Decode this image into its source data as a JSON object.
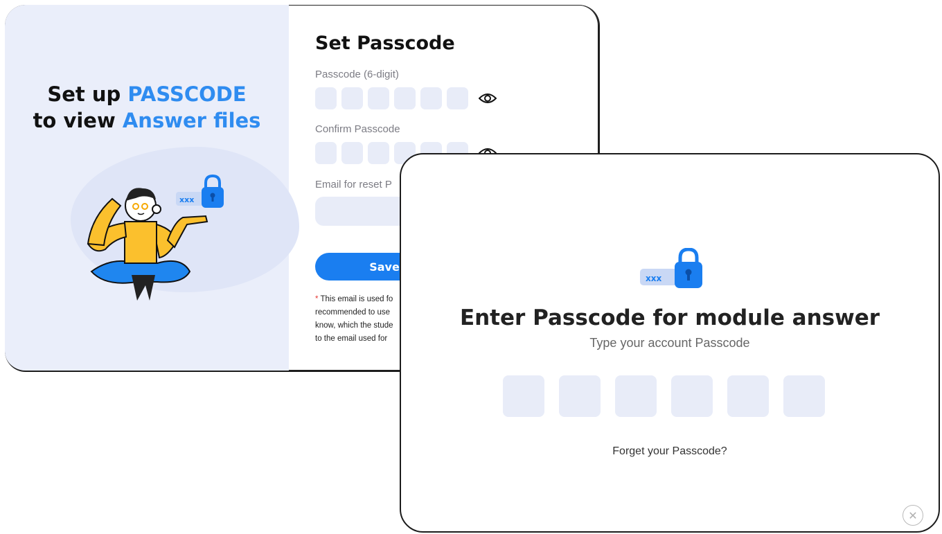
{
  "set_passcode_card": {
    "promo": {
      "line1_prefix": "Set up ",
      "line1_highlight": "PASSCODE",
      "line2_prefix": "to view ",
      "line2_highlight": "Answer files"
    },
    "badge_text": "xxx",
    "title": "Set Passcode",
    "passcode_label": "Passcode (6-digit)",
    "confirm_label": "Confirm Passcode",
    "email_label": "Email for reset P",
    "save_label": "Save",
    "note_star": "*",
    "note_lines": [
      " This email is used fo",
      "recommended to use",
      "know, which the stude",
      "to the email used for"
    ]
  },
  "enter_passcode_modal": {
    "badge_text": "xxx",
    "title": "Enter Passcode for module answer",
    "subtitle": "Type your account Passcode",
    "forgot_link": "Forget your Passcode?",
    "close_icon": "close-icon"
  },
  "colors": {
    "accent": "#2f8cf0",
    "button": "#1a7ef0",
    "input_bg": "#e8ecf8",
    "panel_bg": "#eaeefa",
    "lock": "#1a7ef0",
    "shirt": "#fbc02d"
  }
}
